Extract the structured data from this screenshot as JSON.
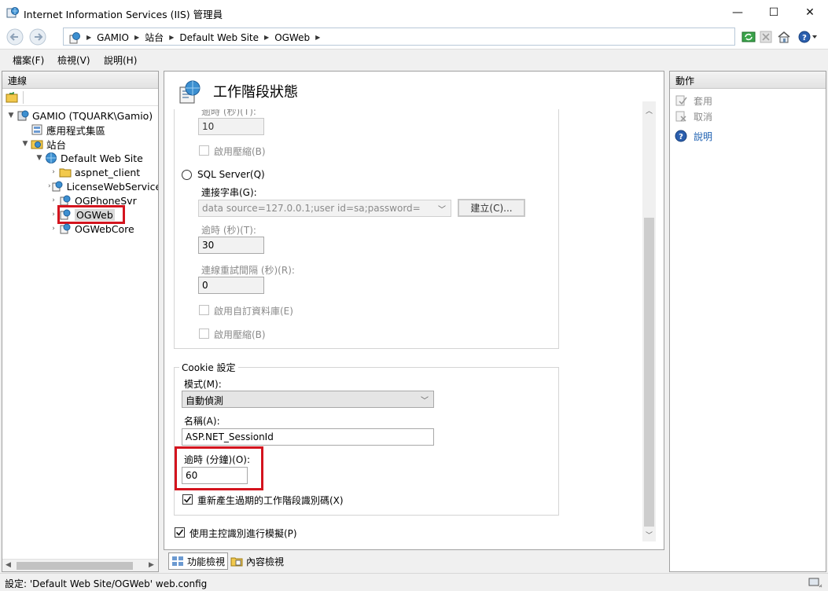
{
  "window": {
    "title": "Internet Information Services (IIS) 管理員",
    "minimize_glyph": "—",
    "maximize_glyph": "☐",
    "close_glyph": "✕"
  },
  "address": {
    "crumbs": [
      "GAMIO",
      "站台",
      "Default Web Site",
      "OGWeb"
    ]
  },
  "menu": {
    "items": [
      "檔案(F)",
      "檢視(V)",
      "說明(H)"
    ]
  },
  "connections": {
    "header": "連線",
    "tree": [
      {
        "label": "GAMIO (TQUARK\\Gamio)"
      },
      {
        "label": "應用程式集區"
      },
      {
        "label": "站台"
      },
      {
        "label": "Default Web Site"
      },
      {
        "label": "aspnet_client"
      },
      {
        "label": "LicenseWebService"
      },
      {
        "label": "OGPhoneSvr"
      },
      {
        "label": "OGWeb"
      },
      {
        "label": "OGWebCore"
      }
    ]
  },
  "page": {
    "title": "工作階段狀態",
    "form": {
      "timeout_sec_label_1": "逾時 (秒)(T):",
      "timeout_sec_value_1": "10",
      "compression_label_1": "啟用壓縮(B)",
      "sql_server_label": "SQL Server(Q)",
      "conn_string_label": "連接字串(G):",
      "conn_string_value": "data source=127.0.0.1;user id=sa;password=",
      "create_button": "建立(C)...",
      "timeout_sec_label_2": "逾時 (秒)(T):",
      "timeout_sec_value_2": "30",
      "retry_interval_label": "連線重試間隔 (秒)(R):",
      "retry_interval_value": "0",
      "custom_db_label": "啟用自訂資料庫(E)",
      "compression_label_2": "啟用壓縮(B)",
      "cookie_group": "Cookie 設定",
      "mode_label": "模式(M):",
      "mode_value": "自動偵測",
      "name_label": "名稱(A):",
      "name_value": "ASP.NET_SessionId",
      "timeout_min_label": "逾時 (分鐘)(O):",
      "timeout_min_value": "60",
      "regenerate_label": "重新產生過期的工作階段識別碼(X)",
      "impersonate_label": "使用主控識別進行模擬(P)"
    },
    "view_tabs": [
      "功能檢視",
      "內容檢視"
    ]
  },
  "actions": {
    "header": "動作",
    "items": [
      "套用",
      "取消",
      "說明"
    ]
  },
  "status": {
    "text": "設定: 'Default Web Site/OGWeb' web.config"
  },
  "colors": {
    "highlight_red": "#d4141e",
    "link_blue": "#1c5fb0",
    "disabled_gray": "#8a8a8a"
  }
}
